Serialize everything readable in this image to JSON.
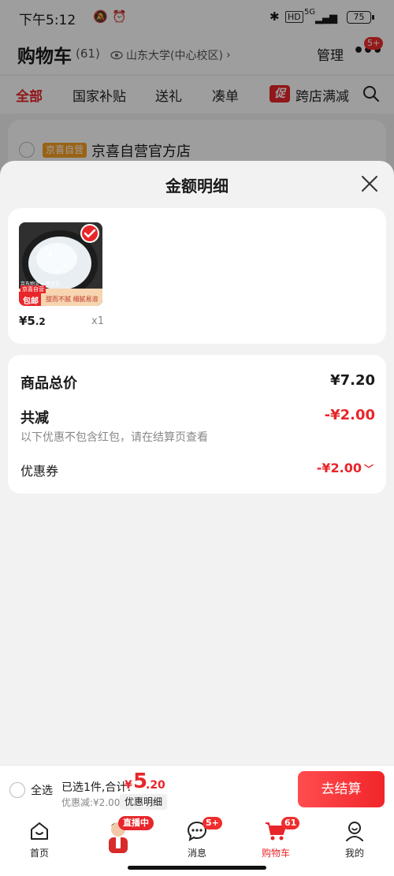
{
  "status": {
    "time": "下午5:12",
    "network": "5G",
    "battery": "75"
  },
  "header": {
    "title": "购物车",
    "count": "(61)",
    "location": "山东大学(中心校区)",
    "manage": "管理",
    "more_badge": "5+"
  },
  "tabs": [
    "全部",
    "国家补贴",
    "送礼",
    "凑单",
    "跨店满减"
  ],
  "tab_promo_tag": "促",
  "store": {
    "tag": "京喜自营",
    "name": "京喜自营官方店"
  },
  "sheet": {
    "title": "金额明细",
    "product": {
      "price_int": "¥5",
      "price_dec": ".2",
      "qty": "x1",
      "img_label_free": "包邮",
      "img_label_brand": "京喜自营",
      "img_slogan": "甜而不腻 细腻易溶",
      "img_top_text": "京东物流 一件也包"
    },
    "summary": {
      "total_label": "商品总价",
      "total_value": "¥7.20",
      "reduce_label": "共减",
      "reduce_value": "-¥2.00",
      "note": "以下优惠不包含红包，请在结算页查看",
      "coupon_label": "优惠券",
      "coupon_value": "-¥2.00"
    }
  },
  "checkout": {
    "select_all": "全选",
    "summary": "已选1件,合计:",
    "currency": "¥",
    "total_int": "5",
    "total_dec": ".20",
    "discount_note": "优惠减:¥2.00",
    "detail_button": "优惠明细",
    "checkout_button": "去结算"
  },
  "nav": {
    "home": "首页",
    "live_badge": "直播中",
    "messages": "消息",
    "messages_badge": "5+",
    "cart": "购物车",
    "cart_badge": "61",
    "mine": "我的"
  },
  "colors": {
    "accent": "#e8262a",
    "store_tag": "#f7a024"
  }
}
